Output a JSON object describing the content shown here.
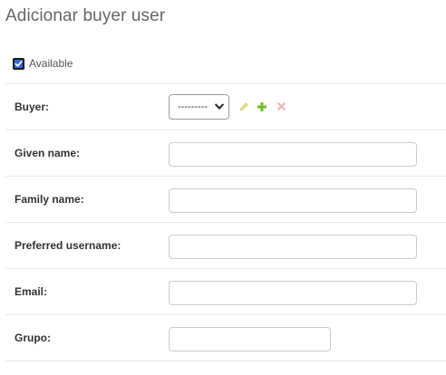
{
  "page": {
    "title": "Adicionar buyer user"
  },
  "available": {
    "label": "Available",
    "checked": true
  },
  "fields": {
    "buyer": {
      "label": "Buyer:",
      "selected": "---------"
    },
    "given_name": {
      "label": "Given name:",
      "value": ""
    },
    "family_name": {
      "label": "Family name:",
      "value": ""
    },
    "preferred_username": {
      "label": "Preferred username:",
      "value": ""
    },
    "email": {
      "label": "Email:",
      "value": ""
    },
    "grupo": {
      "label": "Grupo:",
      "value": ""
    }
  },
  "icons": {
    "edit": "pencil-icon",
    "add": "plus-icon",
    "delete": "x-icon"
  },
  "colors": {
    "checkbox": "#2f66d6",
    "edit_icon": "#e8d98a",
    "add_icon": "#70bf2b",
    "delete_icon": "#f0b5b5"
  }
}
